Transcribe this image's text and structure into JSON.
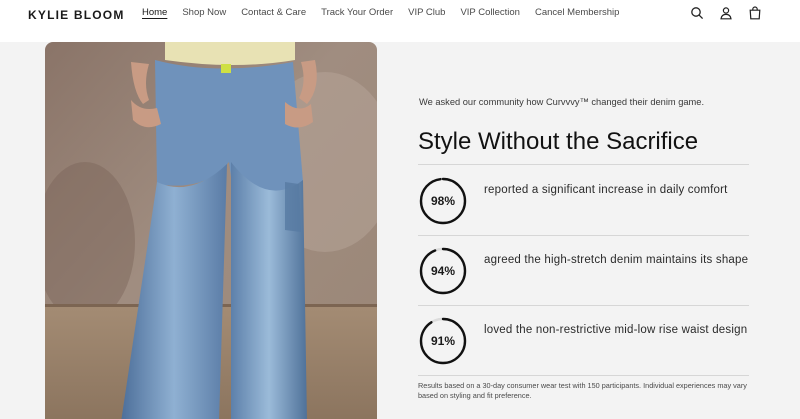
{
  "brand": {
    "logo": "KYLIE BLOOM"
  },
  "nav": {
    "items": [
      {
        "label": "Home",
        "active": true
      },
      {
        "label": "Shop Now"
      },
      {
        "label": "Contact & Care"
      },
      {
        "label": "Track Your Order"
      },
      {
        "label": "VIP Club"
      },
      {
        "label": "VIP Collection"
      },
      {
        "label": "Cancel Membership"
      }
    ]
  },
  "header_icons": [
    "search-icon",
    "account-icon",
    "cart-icon"
  ],
  "hero_image": {
    "subject": "jeans-model-photo"
  },
  "section": {
    "intro": "We asked our community how Curvvvy™ changed their denim game.",
    "title": "Style Without the Sacrifice",
    "stats": [
      {
        "percent": "98%",
        "value": 0.98,
        "text": "reported a significant increase in daily comfort"
      },
      {
        "percent": "94%",
        "value": 0.94,
        "text": "agreed the high-stretch denim maintains its shape"
      },
      {
        "percent": "91%",
        "value": 0.91,
        "text": "loved the non-restrictive mid-low rise waist design"
      }
    ],
    "disclaimer": "Results based on a 30-day consumer wear test with 150 participants. Individual experiences may vary based on styling and fit preference."
  },
  "colors": {
    "background": "#f3f3f3",
    "header": "#ffffff",
    "text": "#121212",
    "ring": "#111111"
  }
}
